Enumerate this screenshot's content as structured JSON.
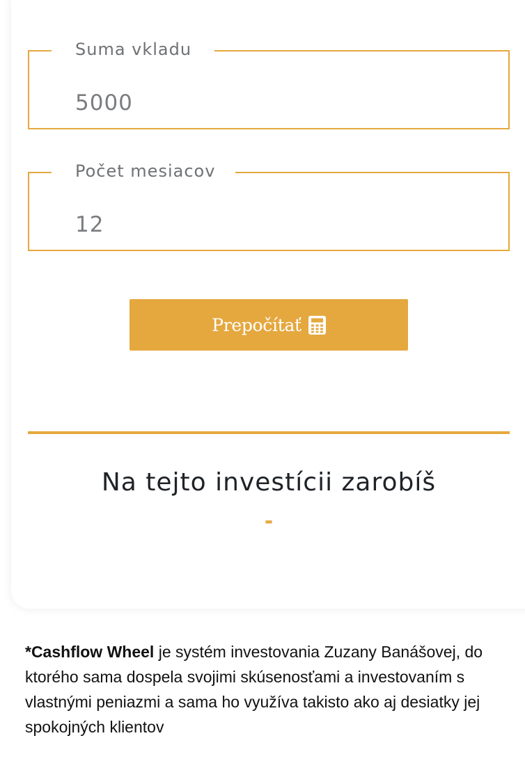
{
  "form": {
    "amount": {
      "label": "Suma vkladu",
      "value": "5000"
    },
    "months": {
      "label": "Počet mesiacov",
      "value": "12"
    },
    "calculate_button": {
      "label": "Prepočítať",
      "icon": "calculator-icon"
    }
  },
  "result": {
    "title": "Na tejto investícii zarobíš",
    "value": "-"
  },
  "footnote": {
    "brand": "*Cashflow Wheel",
    "text": " je systém investovania Zuzany Banášovej, do ktorého sama dospela svojimi skúsenosťami a investovaním s vlastnými peniazmi a sama ho využíva takisto ako aj desiatky jej spokojných klientov"
  },
  "colors": {
    "accent": "#e5a83f",
    "text_dark": "#1f2328",
    "text_muted": "#6f7174"
  }
}
